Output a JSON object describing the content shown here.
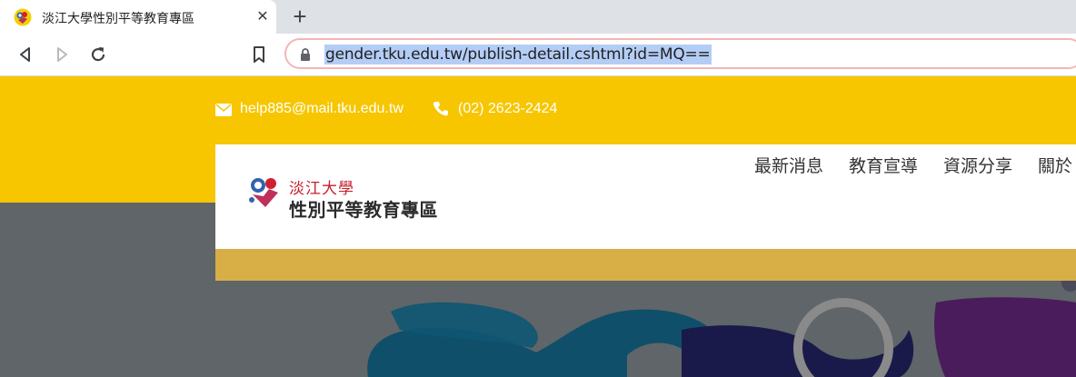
{
  "browser": {
    "tab": {
      "title": "淡江大學性別平等教育專區",
      "close_icon": "close-icon"
    },
    "new_tab_icon": "plus-icon",
    "toolbar": {
      "back_icon": "back-arrow-icon",
      "forward_icon": "forward-arrow-icon",
      "reload_icon": "reload-icon",
      "bookmark_icon": "bookmark-icon"
    },
    "address_bar": {
      "url": "gender.tku.edu.tw/publish-detail.cshtml?id=MQ==",
      "lock_icon": "lock-icon"
    }
  },
  "site": {
    "contact": {
      "email": "help885@mail.tku.edu.tw",
      "phone": "(02) 2623-2424"
    },
    "logo": {
      "top_text": "淡江大學",
      "main_text": "性別平等教育專區"
    },
    "nav": [
      "最新消息",
      "教育宣導",
      "資源分享",
      "關於"
    ]
  },
  "colors": {
    "header_yellow": "#f7c600",
    "card_bottom_gold": "#d8ae47",
    "hero_gray": "#5f6568",
    "url_highlight": "#b4cdf5",
    "logo_red": "#c8202c"
  }
}
